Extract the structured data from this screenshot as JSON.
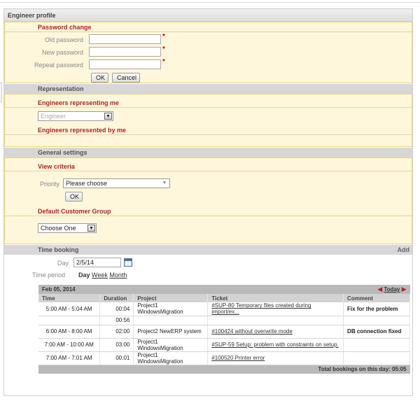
{
  "panel": {
    "title": "Engineer profile"
  },
  "password_change": {
    "header": "Password change",
    "old_label": "Old password",
    "new_label": "New password",
    "repeat_label": "Repeat password",
    "old_value": "",
    "new_value": "",
    "repeat_value": "",
    "required_mark": "*",
    "ok_label": "OK",
    "cancel_label": "Cancel"
  },
  "representation": {
    "header": "Representation",
    "representing_me_header": "Engineers representing me",
    "engineer_select": "Engineer",
    "represented_by_me_header": "Engineers represented by me"
  },
  "general_settings": {
    "header": "General settings",
    "view_criteria_header": "View criteria",
    "priority_label": "Priority",
    "priority_select": "Please choose",
    "ok_label": "OK",
    "default_group_header": "Default Customer Group",
    "group_select": "Choose One"
  },
  "time_booking": {
    "header": "Time booking",
    "add_label": "Add",
    "day_label": "Day",
    "day_value": "2/5/14",
    "period_label": "Time period",
    "period_day": "Day",
    "period_week": "Week",
    "period_month": "Month",
    "date_header": "Feb 05, 2014",
    "today_label": "Today",
    "columns": [
      "Time",
      "Duration",
      "Project",
      "Ticket",
      "Comment"
    ],
    "rows": [
      {
        "time": "5:00 AM - 5:04 AM",
        "duration": "00:04",
        "project": "Project1 WindowsMigration",
        "ticket": "#SUP-80 Temporary files created during import/ex...",
        "comment": "Fix for the problem"
      },
      {
        "time": "",
        "duration": "00:56",
        "project": "",
        "ticket": "",
        "comment": ""
      },
      {
        "time": "6:00 AM - 8:00 AM",
        "duration": "02:00",
        "project": "Project2 NewERP system",
        "ticket": "#100424 without overwrite mode",
        "comment": "DB connection fixed"
      },
      {
        "time": "7:00 AM - 10:00 AM",
        "duration": "03:00",
        "project": "Project1 WindowsMigration",
        "ticket": "#SUP-59 Setup: problem with constraints on setup.",
        "comment": ""
      },
      {
        "time": "7:00 AM - 7:01 AM",
        "duration": "00:01",
        "project": "Project1 WindowsMigration",
        "ticket": "#100520 Printer error",
        "comment": ""
      }
    ],
    "total_label": "Total bookings on this day: 05:05"
  },
  "icons": {
    "calendar": "calendar-icon",
    "prev": "arrow-left-icon",
    "next": "arrow-right-icon",
    "dropdown": "chevron-down-icon"
  },
  "colors": {
    "section_header_red": "#b22222",
    "yellow_bg": "#fff7dc",
    "yellow_border": "#f0d27a",
    "gray_header": "#d7d7d7"
  }
}
